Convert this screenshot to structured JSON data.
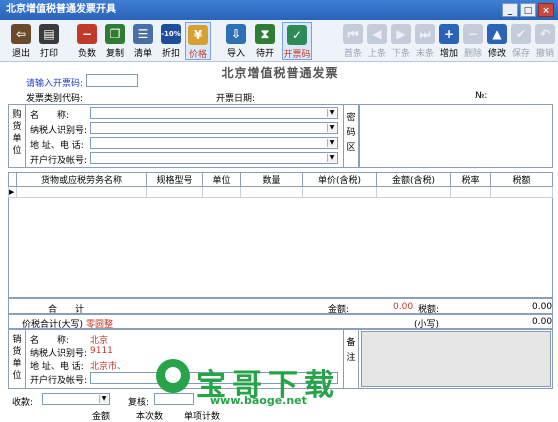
{
  "window": {
    "title": "北京增值税普通发票开具",
    "minimize": "_",
    "maximize": "□",
    "close": "×"
  },
  "toolbar": {
    "left": [
      {
        "label": "退出",
        "icon": "exit-icon",
        "color": "#6b4a2b"
      },
      {
        "label": "打印",
        "icon": "printer-icon",
        "color": "#3b3b3b"
      },
      {
        "label": "负数",
        "icon": "negative-icon",
        "color": "#c0392b"
      },
      {
        "label": "复制",
        "icon": "copy-icon",
        "color": "#2e7d32"
      },
      {
        "label": "清单",
        "icon": "list-icon",
        "color": "#4a6fa5"
      },
      {
        "label": "折扣",
        "icon": "discount-icon",
        "color": "#1f4e9e",
        "icon_text": "-10%"
      },
      {
        "label": "价格",
        "icon": "price-icon",
        "color": "#d8a032"
      },
      {
        "label": "导入",
        "icon": "import-icon",
        "color": "#2f6fb3"
      },
      {
        "label": "待开",
        "icon": "pending-icon",
        "color": "#2e7d32"
      },
      {
        "label": "开票码",
        "icon": "invoice-code-icon",
        "color": "#2e8b57"
      }
    ],
    "right": [
      {
        "label": "首条",
        "icon": "first-icon",
        "disabled": true
      },
      {
        "label": "上条",
        "icon": "prev-icon",
        "disabled": true
      },
      {
        "label": "下条",
        "icon": "next-icon",
        "disabled": true
      },
      {
        "label": "末条",
        "icon": "last-icon",
        "disabled": true
      },
      {
        "label": "增加",
        "icon": "plus-icon",
        "disabled": false,
        "color": "#2a63b8"
      },
      {
        "label": "删除",
        "icon": "minus-icon",
        "disabled": true
      },
      {
        "label": "修改",
        "icon": "edit-icon",
        "disabled": false,
        "color": "#2a63b8"
      },
      {
        "label": "保存",
        "icon": "check-icon",
        "disabled": true
      },
      {
        "label": "撤销",
        "icon": "undo-icon",
        "disabled": true
      }
    ]
  },
  "invoice": {
    "title": "北京增值税普通发票",
    "code_prompt": "请输入开票码:",
    "code_value": "",
    "type_code_label": "发票类别代码:",
    "date_label": "开票日期:",
    "number_label": "№:"
  },
  "buyer": {
    "side_label": "购货单位",
    "fields": [
      {
        "label": "名　　称:",
        "value": ""
      },
      {
        "label": "纳税人识别号:",
        "value": ""
      },
      {
        "label": "地 址、电 话:",
        "value": ""
      },
      {
        "label": "开户行及帐号:",
        "value": ""
      }
    ],
    "cipher_label": "密码区"
  },
  "goods_table": {
    "columns": [
      "货物或应税劳务名称",
      "规格型号",
      "单位",
      "数量",
      "单价(含税)",
      "金额(含税)",
      "税率",
      "税额"
    ],
    "row_marker": "▶"
  },
  "totals": {
    "sum_label": "合　　计",
    "amount_label": "金额:",
    "amount_value": "0.00",
    "tax_label": "税额:",
    "tax_value": "0.00",
    "total_label": "价税合计(大写)",
    "total_upper": "零圆整",
    "small_label": "(小写)",
    "small_value": "0.00"
  },
  "seller": {
    "side_label": "销货单位",
    "fields": [
      {
        "label": "名　　称:",
        "value": "北京"
      },
      {
        "label": "纳税人识别号:",
        "value": "9111"
      },
      {
        "label": "地 址、电 话:",
        "value": "北京市、"
      },
      {
        "label": "开户行及帐号:",
        "value": ""
      }
    ],
    "remark_label": "备注"
  },
  "footer": {
    "payee_label": "收款:",
    "reviewer_label": "复核:",
    "bottom_labels": [
      "金额",
      "本次数",
      "单项计数"
    ]
  },
  "watermark": {
    "text": "宝哥下载",
    "url": "www.baoge.net",
    "color": "#27a34a"
  }
}
